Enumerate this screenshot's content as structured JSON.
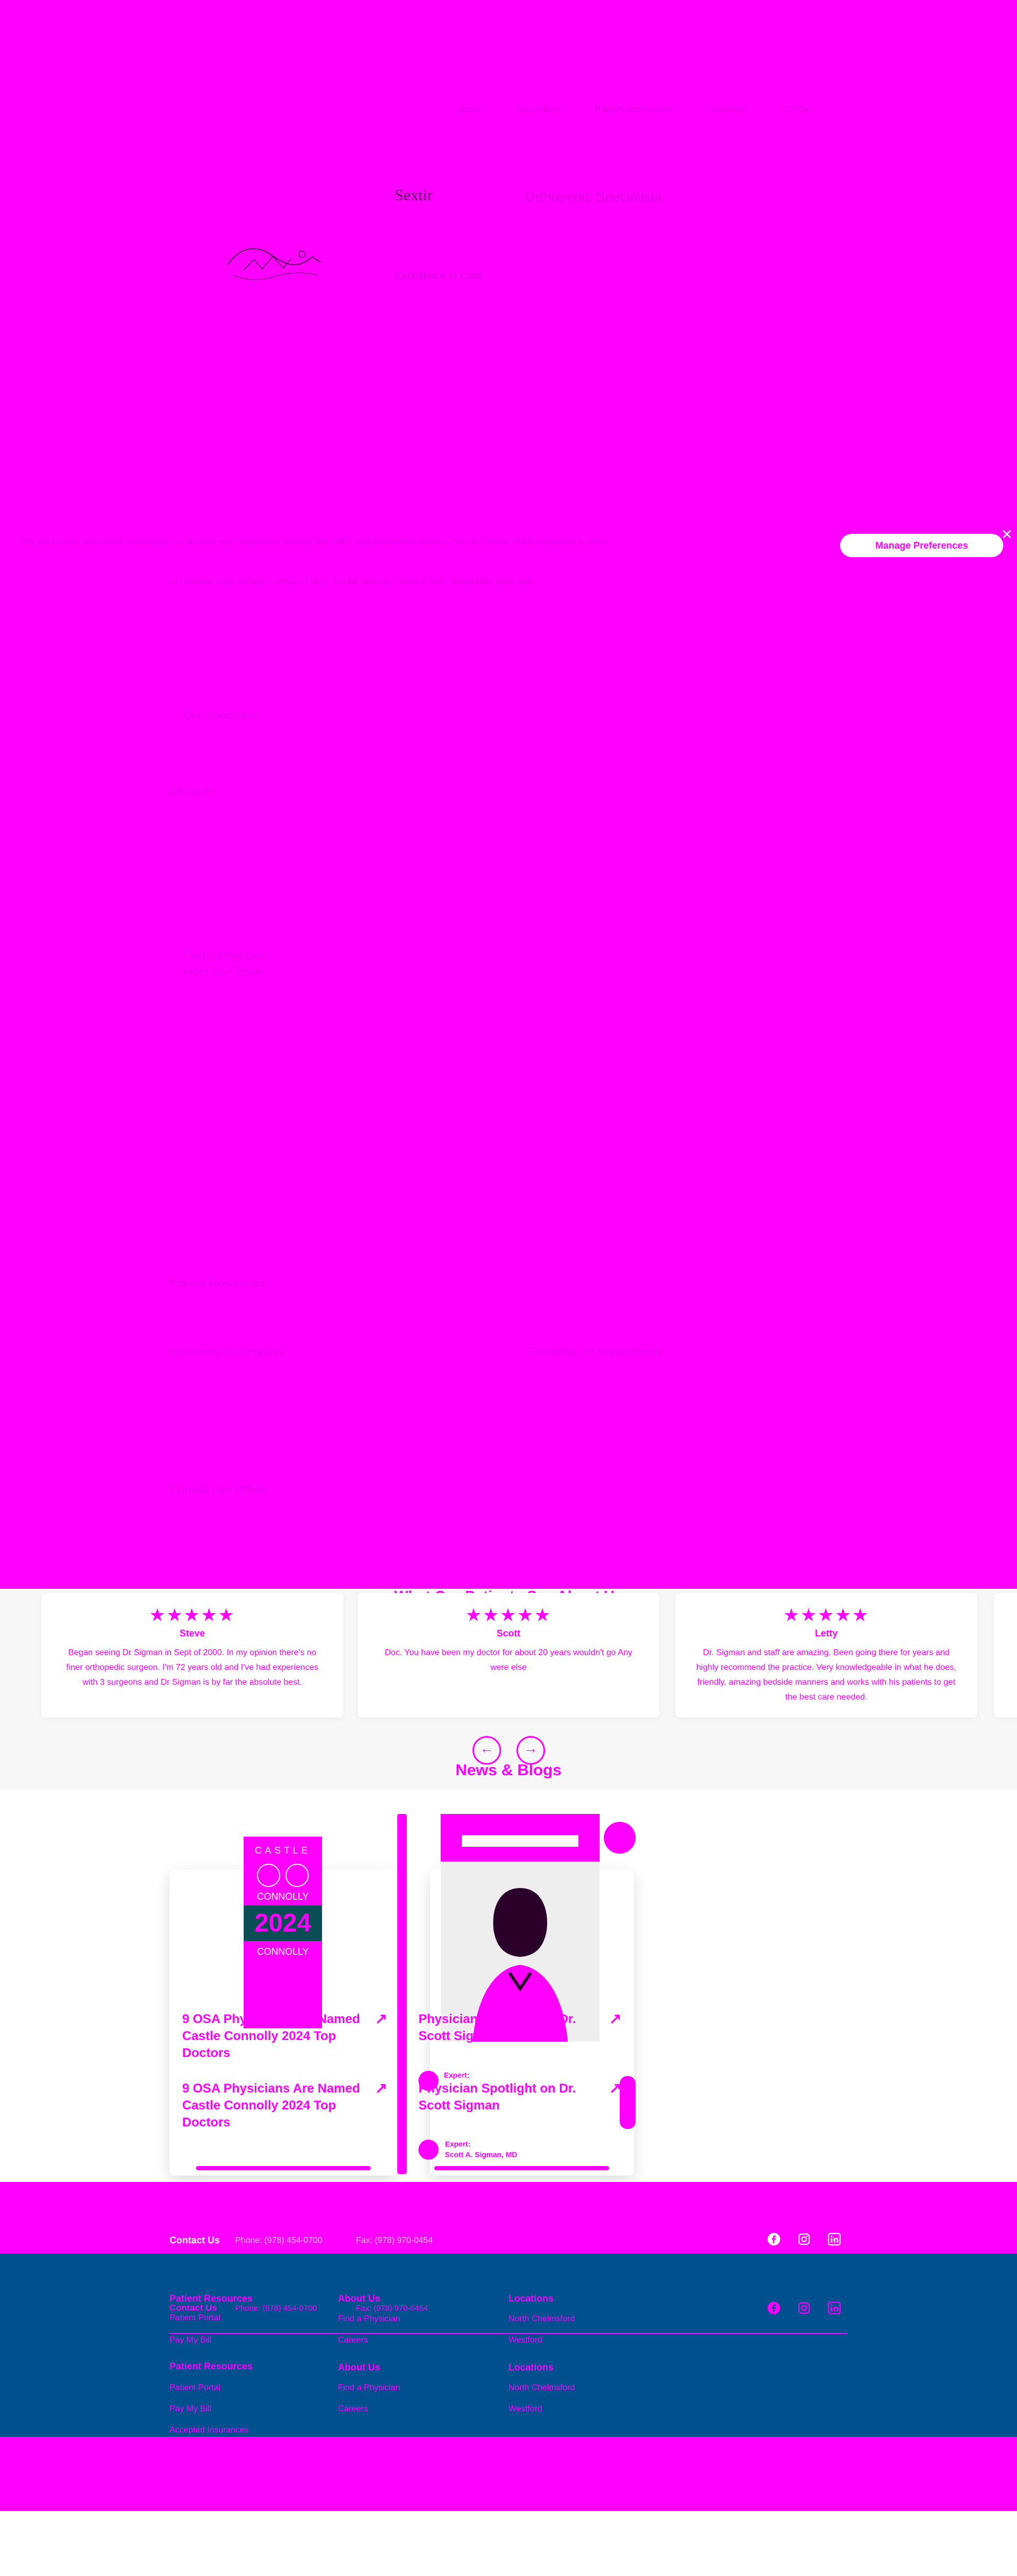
{
  "nav": {
    "items": [
      "About",
      "Specialties",
      "Patient Resources",
      "Locations",
      "Contact"
    ]
  },
  "hero": {
    "title": "Sextir",
    "subtitle": "Orthopedic Specialists",
    "small_text": "Excellence in Care"
  },
  "cookie": {
    "text": "We use cookies and similar technologies to improve your experience, analyze site traffic, and personalize content. You can choose which categories to allow.",
    "manage_label": "Manage Preferences",
    "sub_text": "Our Website Uses Cookies — Privacy Policy · Cookie Settings · Terms of Use · Accessibility Statement"
  },
  "faint_rows": [
    "Our Specialties",
    "Services",
    "Find a Physician",
    "Meet Our Team",
    "Patient Resources",
    "Insurance Information",
    "Schedule an Appointment",
    "Contact Our Office"
  ],
  "testimonials": {
    "title": "What Our Patients Say About Us",
    "stars": "★★★★★",
    "items": [
      {
        "name": "Steve",
        "text": "Began seeing Dr Sigman in Sept of 2000. In my opinion there's no finer orthopedic surgeon. I'm 72 years old and I've had experiences with 3 surgeons and Dr Sigman is by far the absolute best."
      },
      {
        "name": "Scott",
        "text": "Doc. You have been my doctor for about 20 years wouldn't go Any were else"
      },
      {
        "name": "Letty",
        "text": "Dr. Sigman and staff are amazing. Been going there for years and highly recommend the practice. Very knowledgeable in what he does, friendly, amazing bedside manners and works with his patients to get the best care needed."
      }
    ],
    "prev_icon": "arrow-left-icon",
    "next_icon": "arrow-right-icon"
  },
  "news": {
    "title": "News & Blogs",
    "cards": [
      {
        "title": "9 OSA Physicians Are Named Castle Connolly 2024 Top Doctors",
        "logo_top": "CASTLE",
        "logo_mid": "CONNOLLY",
        "logo_year": "2024",
        "logo_bottom": "CONNOLLY"
      },
      {
        "title": "Physician Spotlight on Dr. Scott Sigman",
        "expert_label": "Expert:",
        "expert_name": "Scott A. Sigman, MD"
      }
    ]
  },
  "footer": {
    "contact_label": "Contact Us",
    "phone": "Phone: (978) 454-0700",
    "fax": "Fax: (978) 970-0454",
    "columns": [
      {
        "heading": "Patient Resources",
        "links": [
          "Patient Portal",
          "Pay My Bill",
          "Accepted Insurances"
        ]
      },
      {
        "heading": "About Us",
        "links": [
          "Find a Physician",
          "Careers"
        ]
      },
      {
        "heading": "Locations",
        "links": [
          "North Chelmsford",
          "Westford"
        ]
      }
    ],
    "colors": {
      "bar": "#005090",
      "accent": "#ff00ff"
    }
  }
}
